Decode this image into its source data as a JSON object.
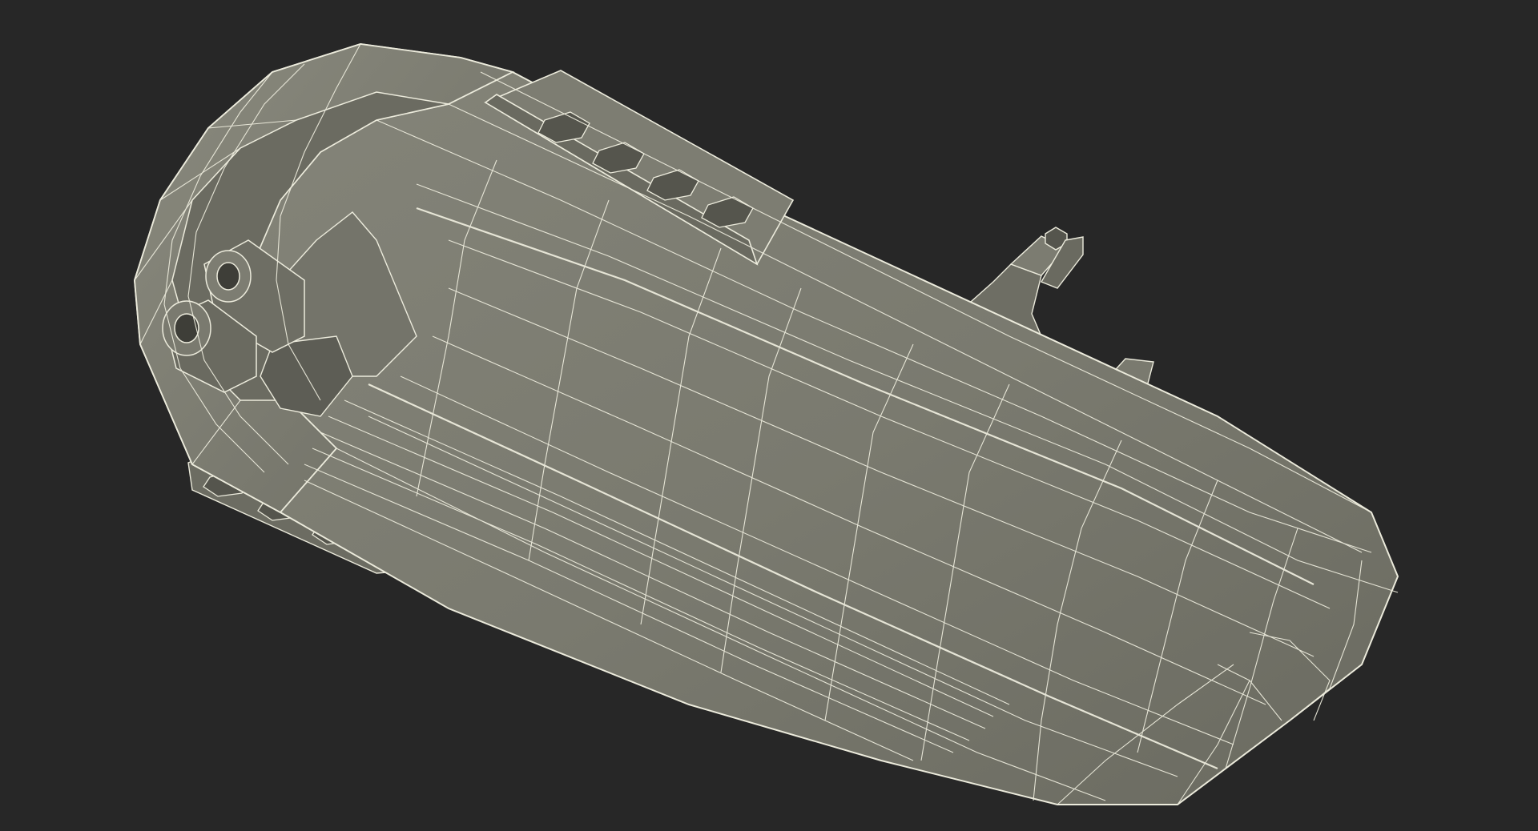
{
  "scene": {
    "background_color": "#272727",
    "model_fill_color": "#7b7b70",
    "model_shade_color": "#5f5f56",
    "model_light_color": "#8e8e82",
    "wire_color": "#ecebdc",
    "subject": "wireframe-3d-model"
  }
}
